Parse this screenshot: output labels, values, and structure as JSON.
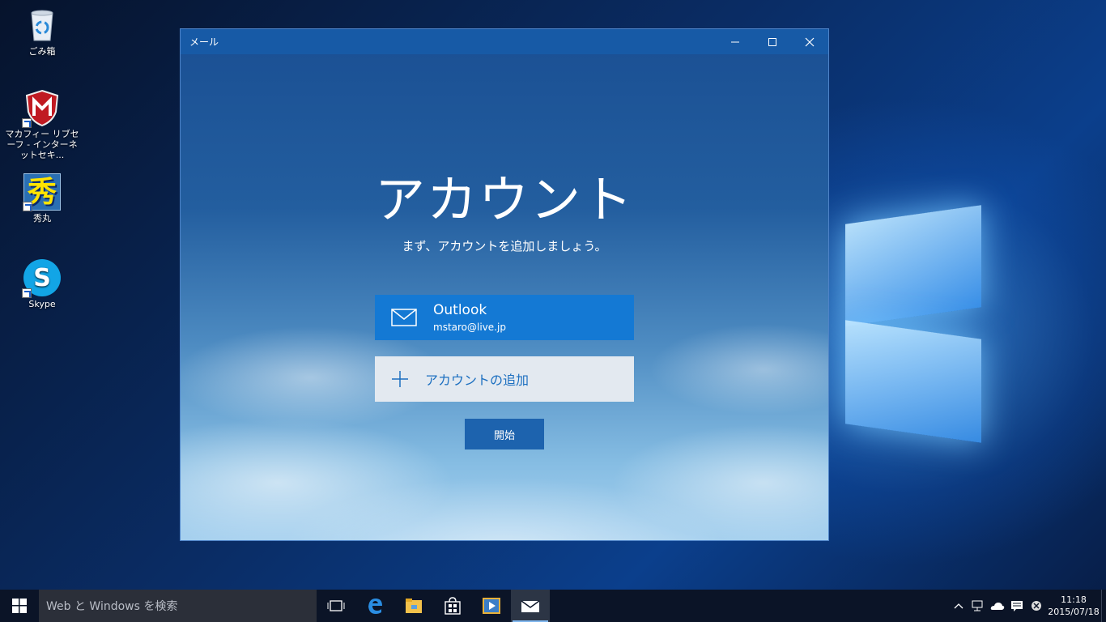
{
  "desktop": {
    "icons": [
      {
        "label": "ごみ箱",
        "icon": "recycle-bin-icon"
      },
      {
        "label": "マカフィー リブセーフ - インターネットセキ...",
        "icon": "mcafee-icon"
      },
      {
        "label": "秀丸",
        "icon": "hidemaru-icon",
        "glyph": "秀"
      },
      {
        "label": "Skype",
        "icon": "skype-icon",
        "glyph": "S"
      }
    ]
  },
  "window": {
    "title": "メール",
    "controls": {
      "minimize": "minimize-icon",
      "maximize": "maximize-icon",
      "close": "close-icon"
    }
  },
  "main": {
    "heading": "アカウント",
    "subtitle": "まず、アカウントを追加しましょう。",
    "account": {
      "name": "Outlook",
      "email": "mstaro@live.jp",
      "icon": "mail-icon"
    },
    "add_account_label": "アカウントの追加",
    "start_label": "開始"
  },
  "taskbar": {
    "search_placeholder": "Web と Windows を検索",
    "apps": [
      "task-view-icon",
      "edge-icon",
      "file-explorer-icon",
      "store-icon",
      "media-player-icon",
      "mail-app-icon"
    ],
    "time": "11:18",
    "date": "2015/07/18"
  },
  "colors": {
    "accent": "#1479d4",
    "titlebar": "#175aa6",
    "start_button": "#1d63ae",
    "taskbar": "#0b1427"
  }
}
